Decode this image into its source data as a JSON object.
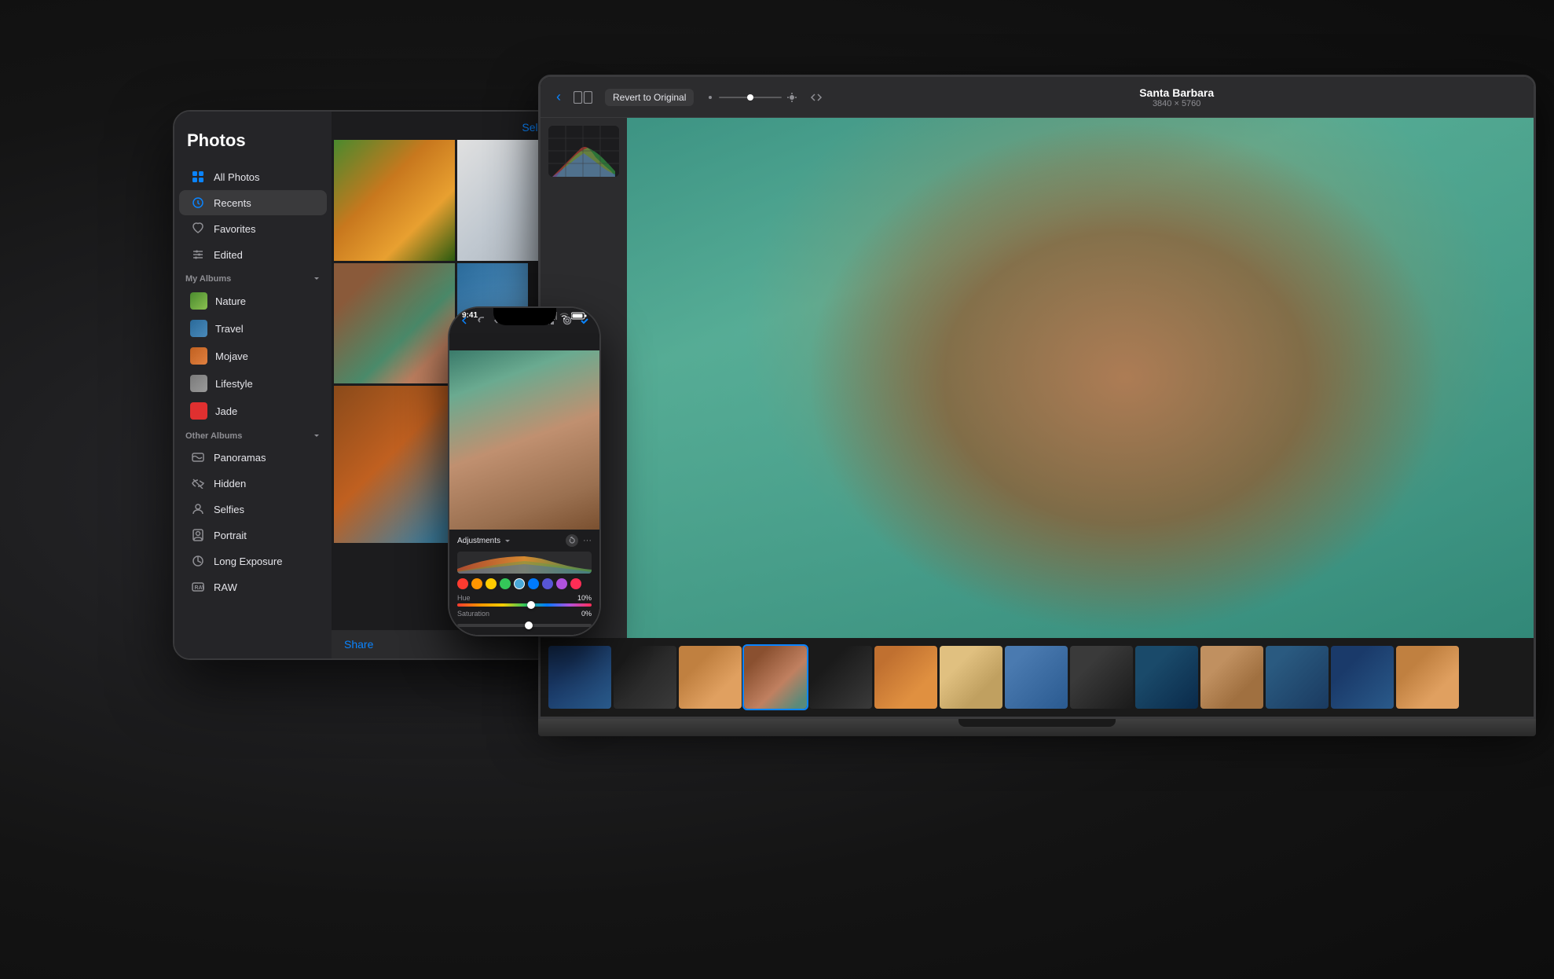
{
  "background": "#1a1a1a",
  "tablet": {
    "sidebar": {
      "title": "Photos",
      "items": [
        {
          "label": "All Photos",
          "icon": "grid",
          "active": false
        },
        {
          "label": "Recents",
          "icon": "clock",
          "active": true
        },
        {
          "label": "Favorites",
          "icon": "heart",
          "active": false
        },
        {
          "label": "Edited",
          "icon": "sliders",
          "active": false
        }
      ],
      "my_albums_header": "My Albums",
      "albums": [
        {
          "label": "Nature",
          "color": "#4a8a2e"
        },
        {
          "label": "Travel",
          "color": "#2a6a9a"
        },
        {
          "label": "Mojave",
          "color": "#c06020"
        },
        {
          "label": "Lifestyle",
          "color": "#8a8a8a"
        },
        {
          "label": "Jade",
          "color": "#e03030"
        }
      ],
      "other_albums_header": "Other Albums",
      "other_albums": [
        {
          "label": "Panoramas",
          "icon": "panorama"
        },
        {
          "label": "Hidden",
          "icon": "eye-slash"
        },
        {
          "label": "Selfies",
          "icon": "person"
        },
        {
          "label": "Portrait",
          "icon": "portrait"
        },
        {
          "label": "Long Exposure",
          "icon": "exposure"
        },
        {
          "label": "RAW",
          "icon": "raw"
        }
      ]
    },
    "select_all": "Select All",
    "share": "Share"
  },
  "phone": {
    "time": "9:41",
    "adjustments_label": "Adjustments",
    "hue_label": "Hue",
    "hue_value": "10%",
    "saturation_label": "Saturation",
    "saturation_value": "0%"
  },
  "laptop": {
    "back_icon": "‹",
    "revert_label": "Revert to Original",
    "photo_title": "Santa Barbara",
    "photo_dims": "3840 × 5760"
  },
  "colors": {
    "accent": "#0a84ff",
    "bg_dark": "#1c1c1e",
    "bg_medium": "#2c2c2e",
    "bg_light": "#3a3a3c",
    "text_primary": "#ffffff",
    "text_secondary": "#8e8e93",
    "red": "#e03030",
    "orange": "#ff9500",
    "yellow": "#ffcc00",
    "green": "#34c759",
    "teal": "#5ac8fa",
    "blue": "#007aff",
    "indigo": "#5856d6",
    "pink": "#ff2d55"
  }
}
